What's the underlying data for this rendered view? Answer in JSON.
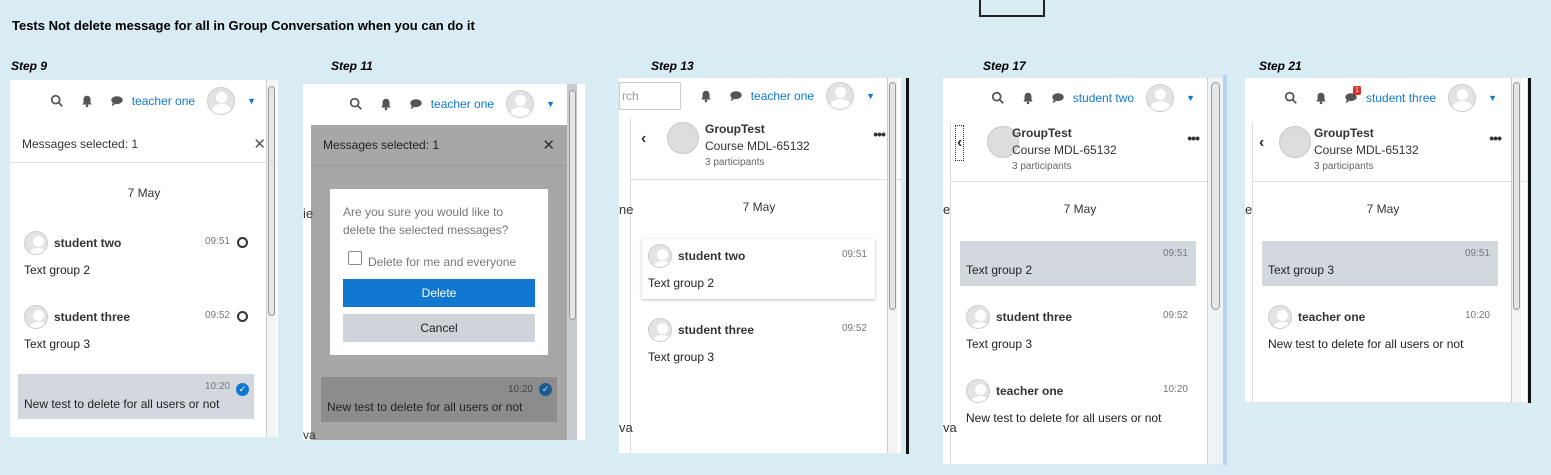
{
  "title": "Tests Not delete message for all in Group Conversation when you can do it",
  "steps": [
    "Step 9",
    "Step 11",
    "Step 13",
    "Step 17",
    "Step 21"
  ],
  "users": {
    "teacher": "teacher one",
    "student2": "student two",
    "student3": "student three"
  },
  "messages_selected": "Messages selected: 1",
  "date": "7 May",
  "group": {
    "name": "GroupTest",
    "course": "Course MDL-65132",
    "participants": "3 participants"
  },
  "messages": {
    "m1": {
      "sender": "student two",
      "time": "09:51",
      "text": "Text group 2"
    },
    "m2": {
      "sender": "student three",
      "time": "09:52",
      "text": "Text group 3"
    },
    "m3": {
      "sender": "teacher one",
      "time": "10:20",
      "text": "New test to delete for all users or not"
    }
  },
  "dialog": {
    "question": "Are you sure you would like to delete the selected messages?",
    "checkbox_label": "Delete for me and everyone",
    "delete_label": "Delete",
    "cancel_label": "Cancel"
  },
  "search_placeholder_fragment": "rch",
  "peek_text": {
    "e": "e",
    "ne": "ne",
    "va": "va",
    "ie": "ie"
  },
  "notification_count": "1",
  "icons": [
    "search-icon",
    "bell-icon",
    "chat-icon",
    "caret-down-icon",
    "close-icon",
    "back-icon",
    "more-icon",
    "check-icon"
  ],
  "colors": {
    "accent": "#1177d1",
    "own_bubble": "#d3d8de",
    "background": "#d9ebf3",
    "badge": "#d9302c"
  }
}
